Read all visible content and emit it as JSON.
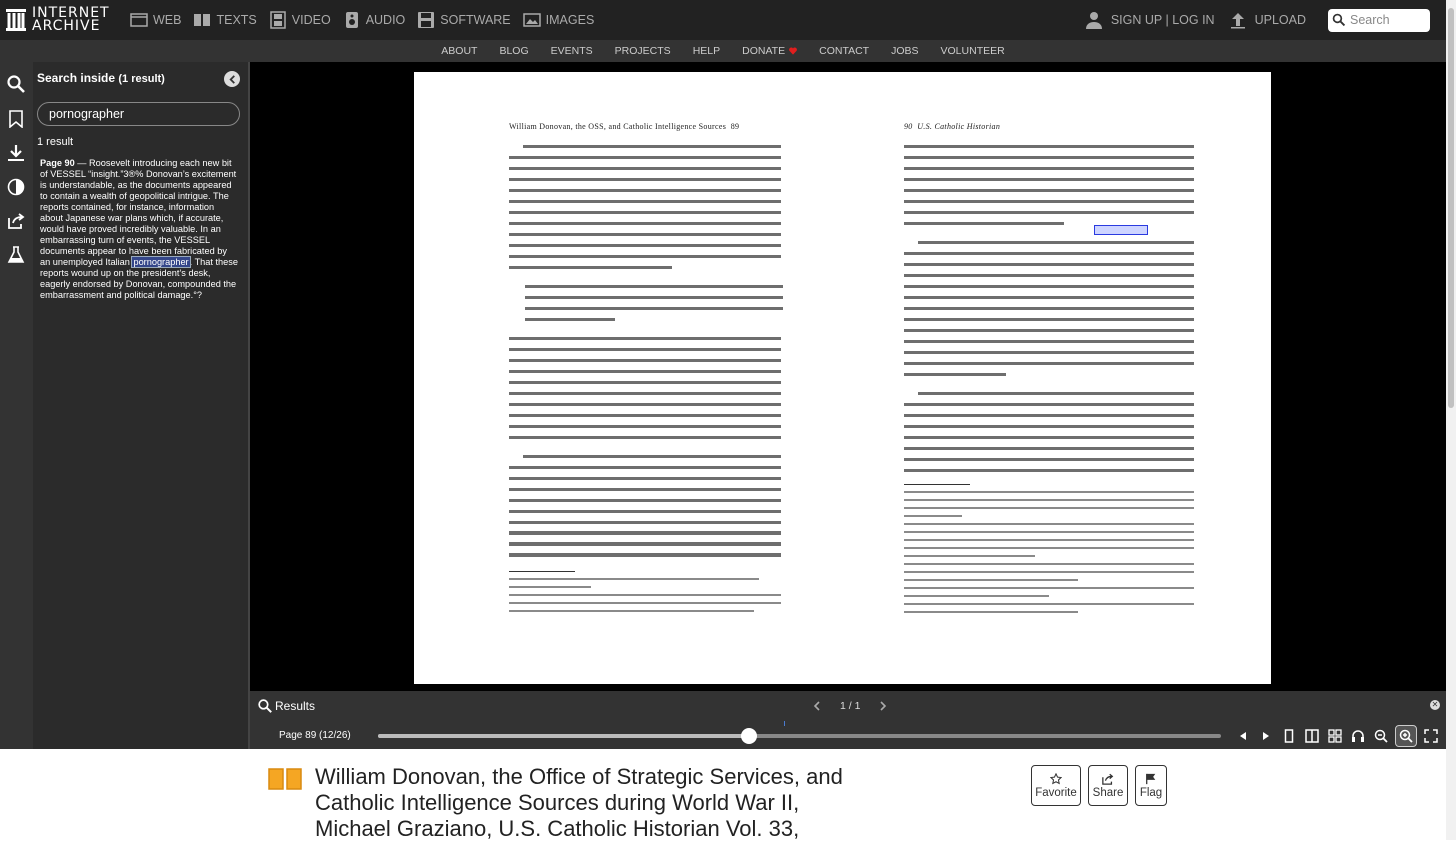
{
  "topnav": {
    "logo_line1": "INTERNET",
    "logo_line2": "ARCHIVE",
    "media": [
      {
        "label": "WEB",
        "icon": "web-icon"
      },
      {
        "label": "TEXTS",
        "icon": "book-icon"
      },
      {
        "label": "VIDEO",
        "icon": "film-icon"
      },
      {
        "label": "AUDIO",
        "icon": "speaker-icon"
      },
      {
        "label": "SOFTWARE",
        "icon": "floppy-icon"
      },
      {
        "label": "IMAGES",
        "icon": "image-icon"
      }
    ],
    "signup": "SIGN UP | LOG IN",
    "upload": "UPLOAD",
    "search_placeholder": "Search"
  },
  "subnav": [
    "ABOUT",
    "BLOG",
    "EVENTS",
    "PROJECTS",
    "HELP",
    "DONATE",
    "CONTACT",
    "JOBS",
    "VOLUNTEER"
  ],
  "search_panel": {
    "title": "Search inside",
    "title_count": "(1 result)",
    "query": "pornographer",
    "count": "1 result",
    "result_page": "Page 90",
    "result_before": " — Roosevelt introducing each new bit of VESSEL “insight.”3®% Donovan’s excitement is understandable, as the documents appeared to contain a wealth of geopolitical intrigue. The reports contained, for instance, information about Japanese war plans which, if accurate, would have proved incredibly valuable. In an embarrassing turn of events, the VESSEL documents appear to have been fabricated by an unemployed Italian ",
    "result_match": "pornographer",
    "result_after": ". That these reports wound up on the president’s desk, eagerly endorsed by Donovan, compounded the embarrassment and political damage.°?"
  },
  "page_left": {
    "running_head": "William Donovan, the OSS, and Catholic Intelligence Sources",
    "page_number": "89"
  },
  "page_right": {
    "page_number": "90",
    "running_head": "U.S. Catholic Historian"
  },
  "results_bar": {
    "label": "Results",
    "pager": "1 / 1"
  },
  "nav_bar": {
    "page_label": "Page 89 (12/26)",
    "progress": 0.44
  },
  "item": {
    "title": "William Donovan, the Office of Strategic Services, and Catholic Intelligence Sources during World War II, Michael Graziano, U.S. Catholic Historian Vol. 33,",
    "favorite": "Favorite",
    "share": "Share",
    "flag": "Flag"
  }
}
